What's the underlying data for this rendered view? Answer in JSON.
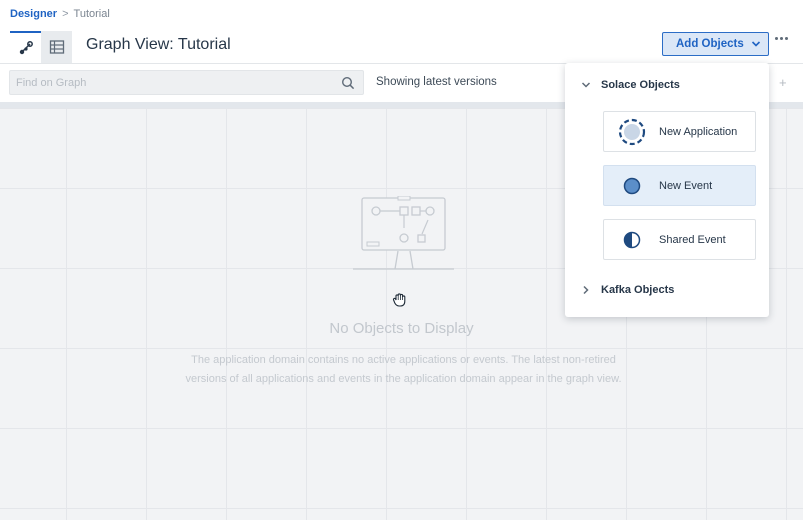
{
  "breadcrumb": {
    "root": "Designer",
    "separator": ">",
    "current": "Tutorial"
  },
  "header": {
    "title": "Graph View: Tutorial",
    "add_objects_label": "Add Objects"
  },
  "toolbar": {
    "search_placeholder": "Find on Graph",
    "versions_text": "Showing latest versions"
  },
  "empty_state": {
    "title": "No Objects to Display",
    "description": "The application domain contains no active applications or events. The latest non-retired versions of all applications and events in the application domain appear in the graph view."
  },
  "dropdown": {
    "solace_section": "Solace Objects",
    "kafka_section": "Kafka Objects",
    "items": [
      {
        "label": "New Application",
        "icon": "application-icon"
      },
      {
        "label": "New Event",
        "icon": "event-icon"
      },
      {
        "label": "Shared Event",
        "icon": "shared-event-icon"
      }
    ]
  },
  "colors": {
    "accent": "#1f63c3",
    "canvas": "#f2f3f5",
    "hover": "#e4eef9"
  }
}
